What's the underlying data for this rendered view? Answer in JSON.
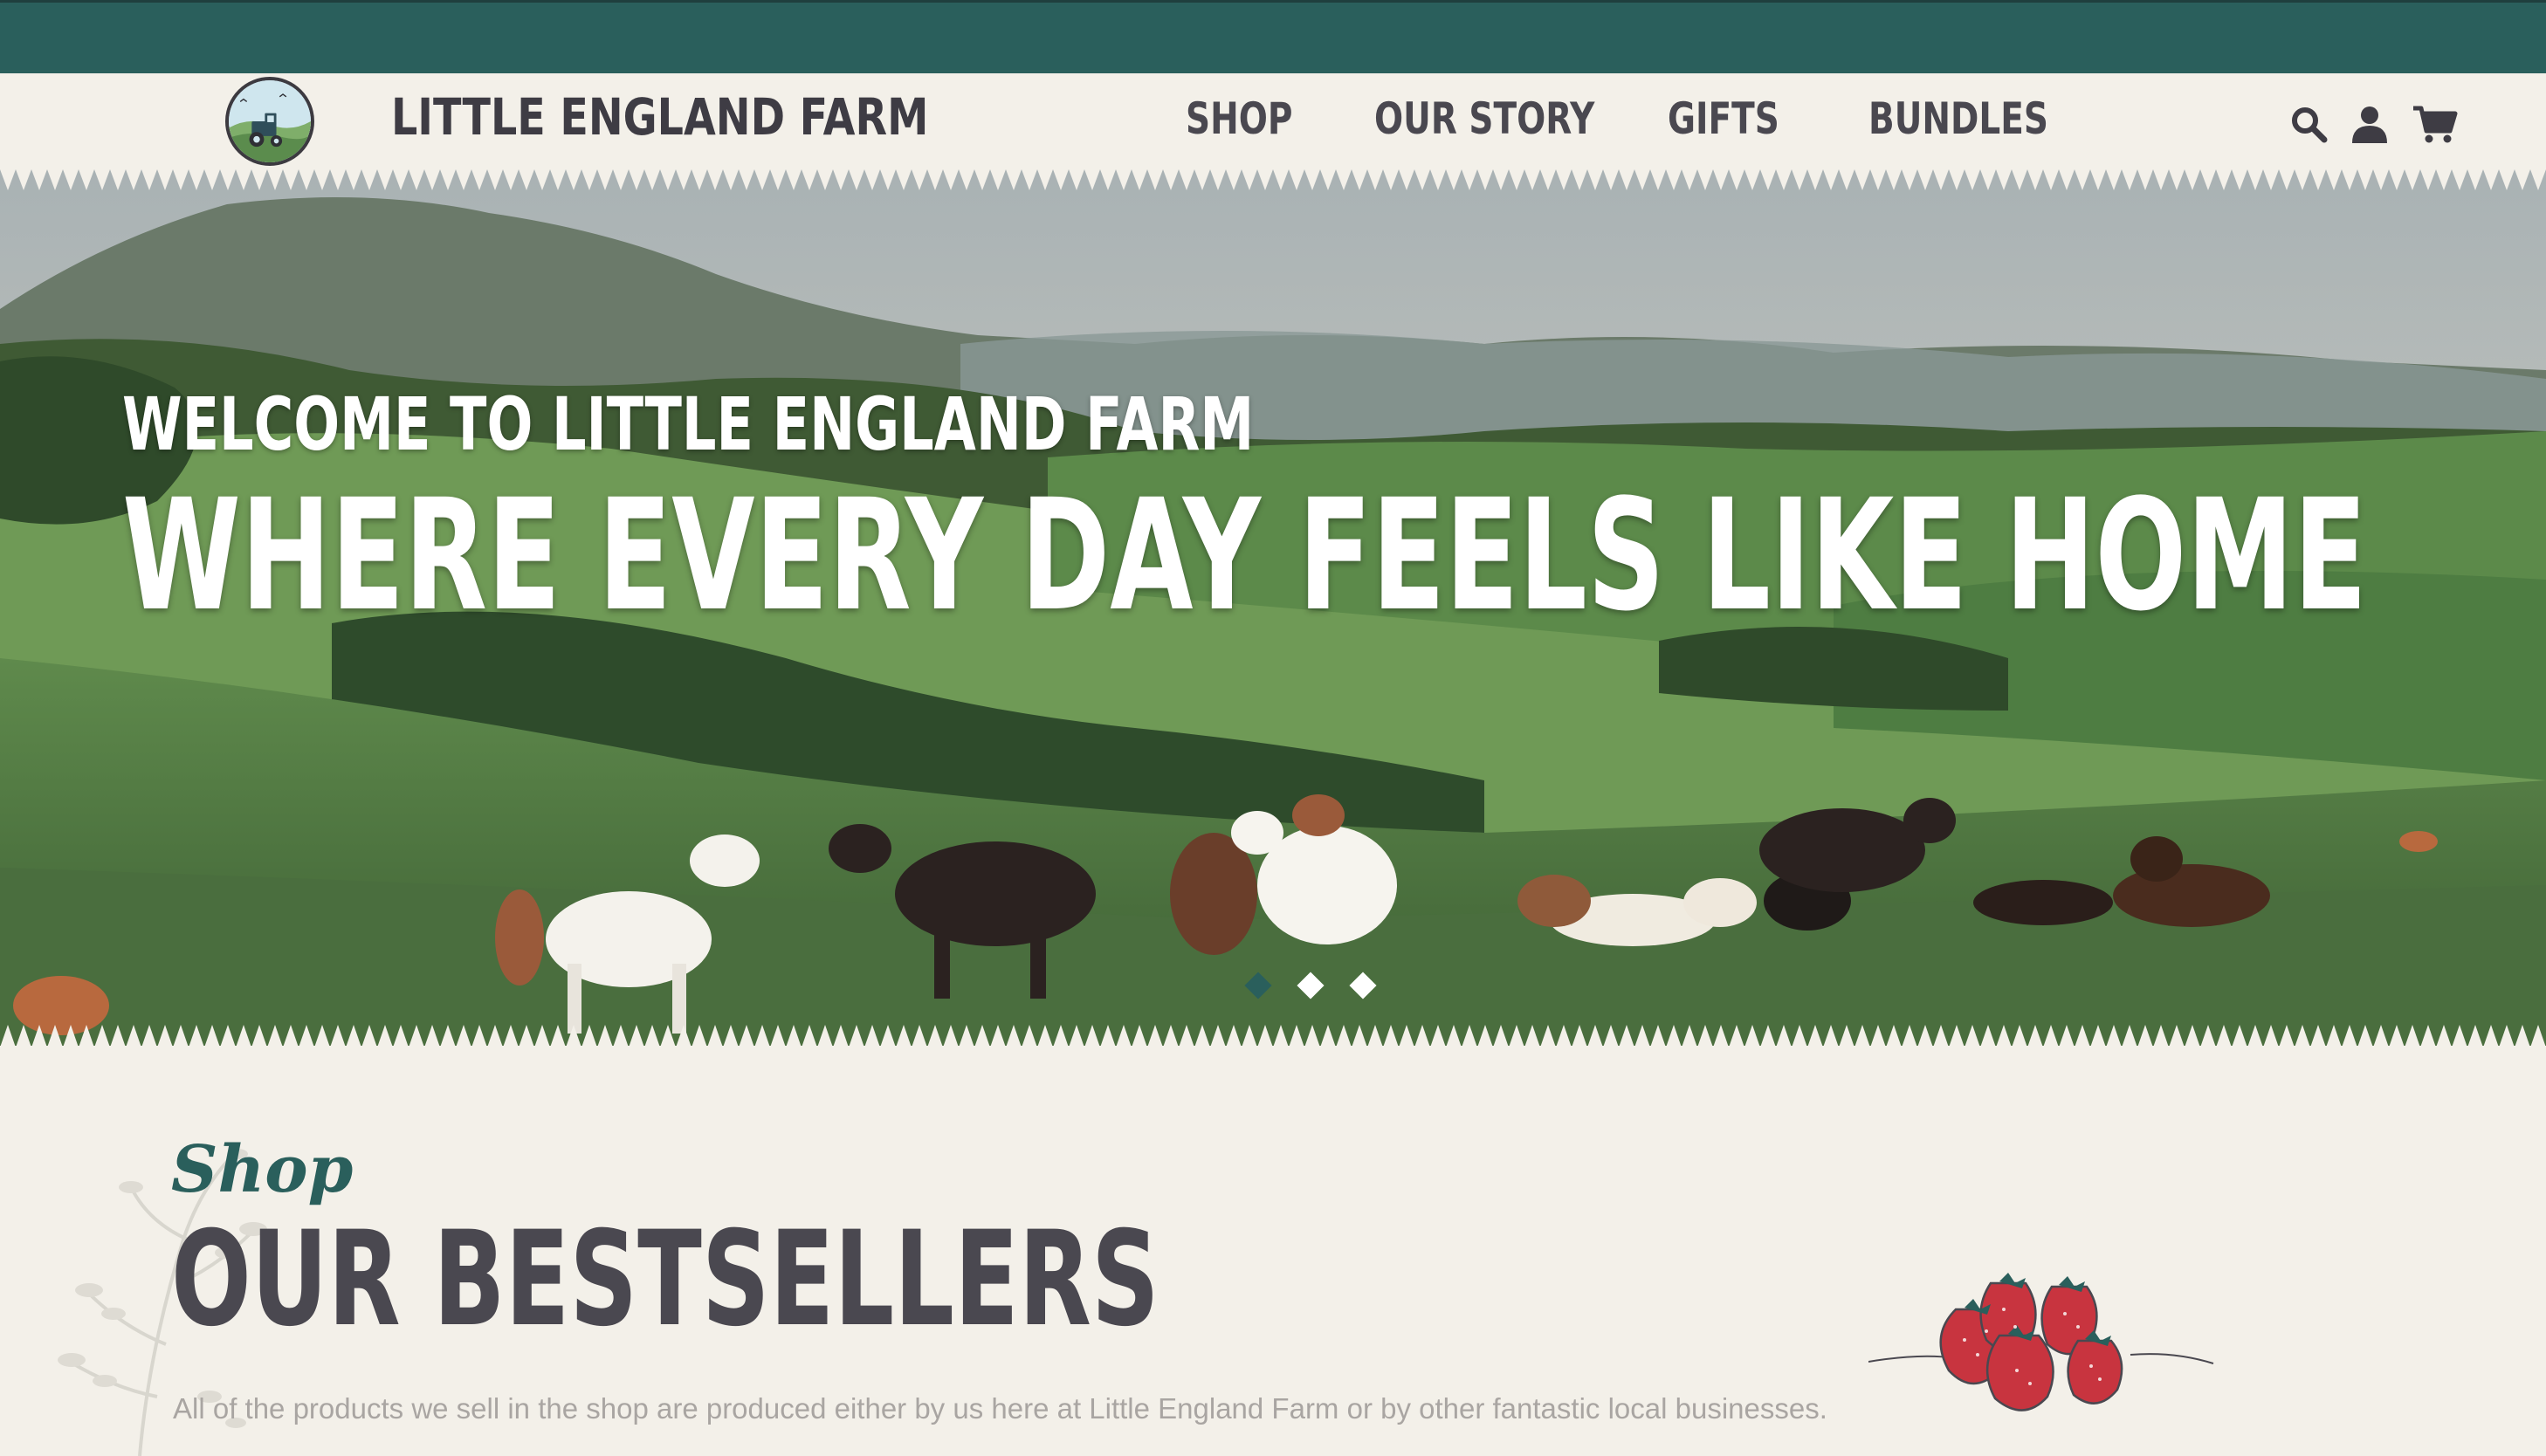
{
  "colors": {
    "brand_teal": "#2a5f5c",
    "text_dark": "#4a4850",
    "background": "#f3f0e9",
    "muted_text": "#a9a5a2",
    "strawberry_red": "#c8343f"
  },
  "header": {
    "brand_name": "LITTLE ENGLAND FARM",
    "logo_icon": "tractor-badge-icon",
    "nav": [
      {
        "label": "SHOP"
      },
      {
        "label": "OUR STORY"
      },
      {
        "label": "GIFTS"
      },
      {
        "label": "BUNDLES"
      }
    ],
    "actions": [
      {
        "icon": "search-icon"
      },
      {
        "icon": "account-icon"
      },
      {
        "icon": "cart-icon"
      }
    ]
  },
  "hero": {
    "kicker": "WELCOME TO LITTLE ENGLAND FARM",
    "title": "WHERE EVERY DAY FEELS LIKE HOME",
    "slides_total": 3,
    "active_slide": 1
  },
  "bestsellers": {
    "script_label": "Shop",
    "title": "OUR BESTSELLERS",
    "description": "All of the products we sell in the shop are produced either by us here at Little England Farm or by other fantastic local businesses.",
    "illustration_icon": "strawberries-icon"
  }
}
